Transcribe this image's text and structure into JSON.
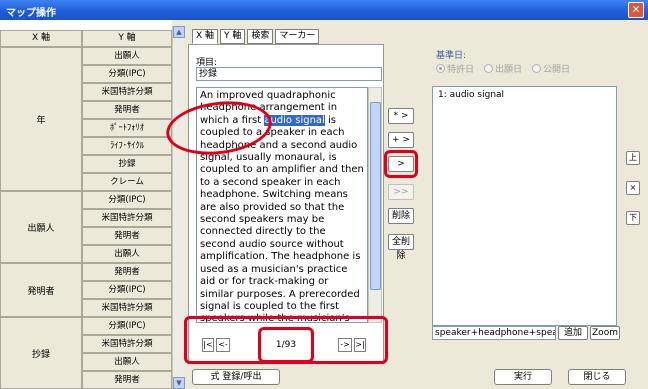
{
  "window": {
    "title": "マップ操作",
    "close_label": "✕"
  },
  "grid": {
    "x_header": "X 軸",
    "y_header": "Y 軸",
    "groups": [
      {
        "label": "年",
        "rows": [
          "出願人",
          "分類(IPC)",
          "米国特許分類",
          "発明者",
          "ﾎﾟｰﾄﾌｫﾘｵ",
          "ﾗｲﾌ･ｻｲｸﾙ",
          "抄録",
          "クレーム"
        ]
      },
      {
        "label": "出願人",
        "rows": [
          "分類(IPC)",
          "米国特許分類",
          "発明者",
          "出願人"
        ]
      },
      {
        "label": "発明者",
        "rows": [
          "発明者",
          "分類(IPC)",
          "米国特許分類"
        ]
      },
      {
        "label": "抄録",
        "rows": [
          "分類(IPC)",
          "米国特許分類",
          "出願人",
          "発明者"
        ]
      }
    ],
    "scroll_up": "▲",
    "scroll_down": "▼"
  },
  "tabs": [
    "X 軸",
    "Y 軸",
    "検索",
    "マーカー"
  ],
  "item": {
    "label": "項目:",
    "value": "抄録"
  },
  "abstract": {
    "before": "An improved quadraphonic headphone arrangement in which a first ",
    "highlight": "audio signal",
    "after": " is coupled to a speaker in each headphone and a second audio signal, usually monaural, is coupled to an amplifier and then to a second speaker in each headphone. Switching means are also provided so that the second speakers may be connected directly to the second audio source without amplification. The headphone is used as a musician's practice aid or for track-making or similar purposes. A prerecorded signal is coupled to the first speakers while the musician's electronic instrument output is"
  },
  "nav": {
    "first": "|<",
    "prev": "<-",
    "page": "1/93",
    "next": "->",
    "last": ">|"
  },
  "move_buttons": {
    "add_all": "* >",
    "add": "+ >",
    "move": ">",
    "move_all": ">>",
    "delete": "削除",
    "delete_all": "全削除"
  },
  "base_date": {
    "label": "基準日:",
    "options": [
      "特許日",
      "出願日",
      "公開日"
    ],
    "selected": "特許日"
  },
  "selected_list": [
    "1: audio signal"
  ],
  "side_buttons": {
    "up": "上",
    "remove": "×",
    "down": "下"
  },
  "query": {
    "value": "speaker+headphone+speak",
    "add_label": "追加",
    "zoom_label": "Zoom"
  },
  "bottom": {
    "expr_label": "式 登録/呼出",
    "run_label": "実行",
    "close_label": "閉じる"
  }
}
